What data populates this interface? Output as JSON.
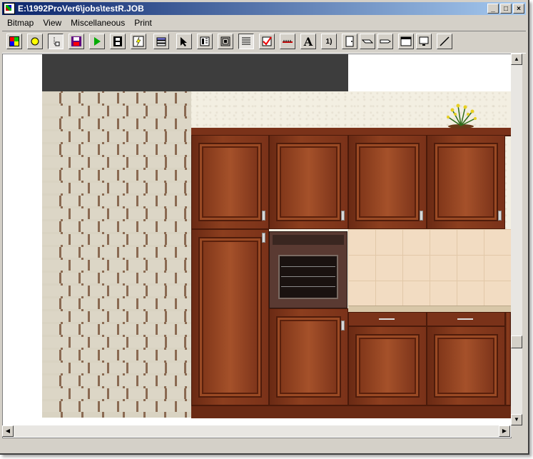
{
  "window": {
    "title": "E:\\1992ProVer6\\jobs\\testR.JOB",
    "minimize_label": "_",
    "maximize_label": "□",
    "close_label": "×"
  },
  "menu": {
    "items": [
      "Bitmap",
      "View",
      "Miscellaneous",
      "Print"
    ]
  },
  "toolbar": {
    "tools": [
      {
        "name": "color-palette-icon"
      },
      {
        "name": "yellow-circle-icon"
      },
      {
        "name": "pointer-hand-icon"
      },
      {
        "name": "save-disk-icon"
      },
      {
        "name": "play-icon"
      },
      {
        "name": "film-strip-icon"
      },
      {
        "name": "lightning-icon"
      },
      {
        "name": "stack-icon"
      },
      {
        "name": "select-arrow-icon"
      },
      {
        "name": "grid-icon"
      },
      {
        "name": "frame-icon"
      },
      {
        "name": "lines-icon"
      },
      {
        "name": "checklist-icon"
      },
      {
        "name": "measure-icon"
      },
      {
        "name": "text-A-icon",
        "label": "A"
      },
      {
        "name": "numbering-icon",
        "label": "1)"
      },
      {
        "name": "door-icon"
      },
      {
        "name": "wall-section-icon"
      },
      {
        "name": "wall-side-icon"
      },
      {
        "name": "window-icon"
      },
      {
        "name": "monitor-icon"
      },
      {
        "name": "diagonal-line-icon"
      }
    ],
    "active_tool": "select-arrow-icon"
  },
  "colors": {
    "titlebar_start": "#0a246a",
    "titlebar_end": "#a6caf0",
    "wood": "#7a3219",
    "wall": "#f3efe2",
    "tile": "#f2dcc2"
  }
}
